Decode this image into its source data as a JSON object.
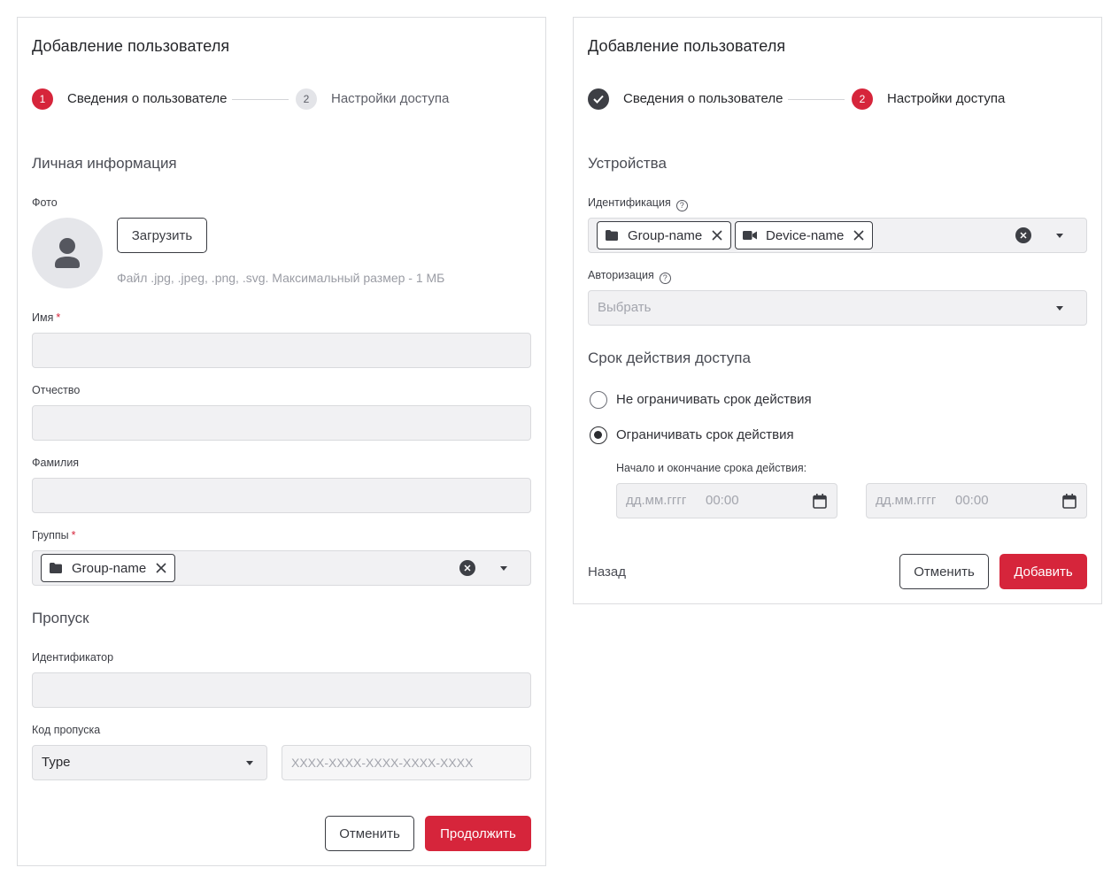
{
  "left_panel": {
    "title": "Добавление пользователя",
    "stepper": {
      "step1": {
        "number": "1",
        "label": "Сведения о пользователе",
        "state": "active"
      },
      "step2": {
        "number": "2",
        "label": "Настройки доступа",
        "state": "inactive"
      }
    },
    "personal_section_title": "Личная информация",
    "photo_label": "Фото",
    "upload_button": "Загрузить",
    "upload_hint": "Файл .jpg, .jpeg, .png, .svg. Максимальный размер - 1 МБ",
    "first_name_label": "Имя",
    "patronymic_label": "Отчество",
    "last_name_label": "Фамилия",
    "groups_label": "Группы",
    "groups_chip": "Group-name",
    "required_mark": "*",
    "pass_section_title": "Пропуск",
    "identifier_label": "Идентификатор",
    "pass_code_label": "Код пропуска",
    "pass_type_value": "Type",
    "pass_code_placeholder": "XXXX-XXXX-XXXX-XXXX-XXXX",
    "cancel_button": "Отменить",
    "continue_button": "Продолжить"
  },
  "right_panel": {
    "title": "Добавление пользователя",
    "stepper": {
      "step1": {
        "label": "Сведения о пользователе",
        "state": "done"
      },
      "step2": {
        "number": "2",
        "label": "Настройки доступа",
        "state": "active"
      }
    },
    "devices_section_title": "Устройства",
    "identification_label": "Идентификация",
    "identification_chips": [
      "Group-name",
      "Device-name"
    ],
    "authorization_label": "Авторизация",
    "authorization_placeholder": "Выбрать",
    "validity_section_title": "Срок действия доступа",
    "radio_unlimited_label": "Не ограничивать срок действия",
    "radio_limited_label": "Ограничивать срок действия",
    "selected_option": "limited",
    "period_label": "Начало и окончание срока действия:",
    "start": {
      "date_placeholder": "дд.мм.гггг",
      "time_placeholder": "00:00"
    },
    "end": {
      "date_placeholder": "дд.мм.гггг",
      "time_placeholder": "00:00"
    },
    "back_button": "Назад",
    "cancel_button": "Отменить",
    "add_button": "Добавить"
  },
  "colors": {
    "accent": "#d6253b",
    "dark": "#3d3f45",
    "input_bg": "#f1f1f3",
    "border": "#dcdde0"
  },
  "icons": [
    "user-avatar-icon",
    "folder-icon",
    "camera-icon",
    "close-icon",
    "clear-circle-icon",
    "caret-down-icon",
    "help-icon",
    "calendar-icon",
    "check-icon"
  ]
}
